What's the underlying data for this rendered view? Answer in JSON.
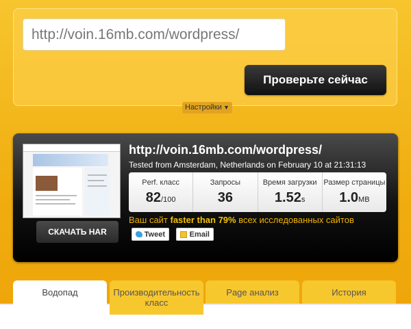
{
  "search": {
    "url_value": "http://voin.16mb.com/wordpress/",
    "check_button": "Проверьте сейчас",
    "settings_label": "Настройки"
  },
  "result": {
    "url": "http://voin.16mb.com/wordpress/",
    "tested_line": "Tested from Amsterdam, Netherlands on February 10 at 21:31:13",
    "har_button": "СКАЧАТЬ HAR",
    "stats": {
      "perf_label": "Perf. класс",
      "perf_value": "82",
      "perf_unit": "/100",
      "requests_label": "Запросы",
      "requests_value": "36",
      "load_time_label": "Время загрузки",
      "load_time_value": "1.52",
      "load_time_unit": "s",
      "page_size_label": "Размер страницы",
      "page_size_value": "1.0",
      "page_size_unit": "MB"
    },
    "summary": {
      "before": "Ваш сайт ",
      "highlight": "faster than 79%",
      "after": " всех исследованных сайтов"
    },
    "tweet_label": "Tweet",
    "email_label": "Email"
  },
  "tabs": [
    {
      "label": "Водопад"
    },
    {
      "label": "Производительность класс"
    },
    {
      "label": "Page анализ"
    },
    {
      "label": "История"
    }
  ]
}
